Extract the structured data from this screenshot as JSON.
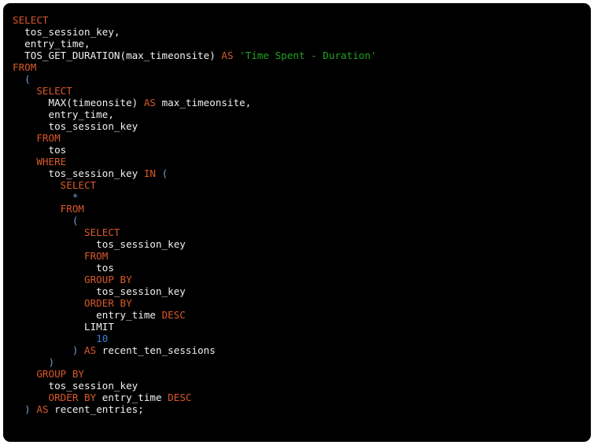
{
  "window": {
    "background_color": "#ffffff",
    "code_background_color": "#000000",
    "corner_radius_px": 9
  },
  "theme": {
    "keyword_color": "#d9582a",
    "string_color": "#1fa51f",
    "number_color": "#3b7fd4",
    "punctuation_color": "#6f9fd8",
    "identifier_color": "#f0f0f0"
  },
  "code": {
    "language": "sql",
    "full_text": "SELECT\n  tos_session_key,\n  entry_time,\n  TOS_GET_DURATION(max_timeonsite) AS 'Time Spent - Duration'\nFROM\n  (\n    SELECT\n      MAX(timeonsite) AS max_timeonsite,\n      entry_time,\n      tos_session_key\n    FROM\n      tos\n    WHERE\n      tos_session_key IN (\n        SELECT\n          *\n        FROM\n          (\n            SELECT\n              tos_session_key\n            FROM\n              tos\n            GROUP BY\n              tos_session_key\n            ORDER BY\n              entry_time DESC\n            LIMIT\n              10\n          ) AS recent_ten_sessions\n      )\n    GROUP BY\n      tos_session_key\n      ORDER BY entry_time DESC\n  ) AS recent_entries;",
    "lines": [
      {
        "n": 1,
        "text": "SELECT"
      },
      {
        "n": 2,
        "text": "  tos_session_key,"
      },
      {
        "n": 3,
        "text": "  entry_time,"
      },
      {
        "n": 4,
        "text": "  TOS_GET_DURATION(max_timeonsite) AS 'Time Spent - Duration'"
      },
      {
        "n": 5,
        "text": "FROM"
      },
      {
        "n": 6,
        "text": "  ("
      },
      {
        "n": 7,
        "text": "    SELECT"
      },
      {
        "n": 8,
        "text": "      MAX(timeonsite) AS max_timeonsite,"
      },
      {
        "n": 9,
        "text": "      entry_time,"
      },
      {
        "n": 10,
        "text": "      tos_session_key"
      },
      {
        "n": 11,
        "text": "    FROM"
      },
      {
        "n": 12,
        "text": "      tos"
      },
      {
        "n": 13,
        "text": "    WHERE"
      },
      {
        "n": 14,
        "text": "      tos_session_key IN ("
      },
      {
        "n": 15,
        "text": "        SELECT"
      },
      {
        "n": 16,
        "text": "          *"
      },
      {
        "n": 17,
        "text": "        FROM"
      },
      {
        "n": 18,
        "text": "          ("
      },
      {
        "n": 19,
        "text": "            SELECT"
      },
      {
        "n": 20,
        "text": "              tos_session_key"
      },
      {
        "n": 21,
        "text": "            FROM"
      },
      {
        "n": 22,
        "text": "              tos"
      },
      {
        "n": 23,
        "text": "            GROUP BY"
      },
      {
        "n": 24,
        "text": "              tos_session_key"
      },
      {
        "n": 25,
        "text": "            ORDER BY"
      },
      {
        "n": 26,
        "text": "              entry_time DESC"
      },
      {
        "n": 27,
        "text": "            LIMIT"
      },
      {
        "n": 28,
        "text": "              10"
      },
      {
        "n": 29,
        "text": "          ) AS recent_ten_sessions"
      },
      {
        "n": 30,
        "text": "      )"
      },
      {
        "n": 31,
        "text": "    GROUP BY"
      },
      {
        "n": 32,
        "text": "      tos_session_key"
      },
      {
        "n": 33,
        "text": "      ORDER BY entry_time DESC"
      },
      {
        "n": 34,
        "text": "  ) AS recent_entries;"
      }
    ],
    "tokens": [
      [
        {
          "t": "SELECT",
          "c": "kw"
        }
      ],
      [
        {
          "t": "  ",
          "c": "plain"
        },
        {
          "t": "tos_session_key,",
          "c": "id"
        }
      ],
      [
        {
          "t": "  ",
          "c": "plain"
        },
        {
          "t": "entry_time,",
          "c": "id"
        }
      ],
      [
        {
          "t": "  ",
          "c": "plain"
        },
        {
          "t": "TOS_GET_DURATION(max_timeonsite) ",
          "c": "id"
        },
        {
          "t": "AS",
          "c": "kw"
        },
        {
          "t": " ",
          "c": "plain"
        },
        {
          "t": "'Time Spent - Duration'",
          "c": "str"
        }
      ],
      [
        {
          "t": "FROM",
          "c": "kw"
        }
      ],
      [
        {
          "t": "  ",
          "c": "plain"
        },
        {
          "t": "(",
          "c": "punc"
        }
      ],
      [
        {
          "t": "    ",
          "c": "plain"
        },
        {
          "t": "SELECT",
          "c": "kw"
        }
      ],
      [
        {
          "t": "      ",
          "c": "plain"
        },
        {
          "t": "MAX(timeonsite) ",
          "c": "id"
        },
        {
          "t": "AS",
          "c": "kw"
        },
        {
          "t": " max_timeonsite,",
          "c": "id"
        }
      ],
      [
        {
          "t": "      ",
          "c": "plain"
        },
        {
          "t": "entry_time,",
          "c": "id"
        }
      ],
      [
        {
          "t": "      ",
          "c": "plain"
        },
        {
          "t": "tos_session_key",
          "c": "id"
        }
      ],
      [
        {
          "t": "    ",
          "c": "plain"
        },
        {
          "t": "FROM",
          "c": "kw"
        }
      ],
      [
        {
          "t": "      ",
          "c": "plain"
        },
        {
          "t": "tos",
          "c": "id"
        }
      ],
      [
        {
          "t": "    ",
          "c": "plain"
        },
        {
          "t": "WHERE",
          "c": "kw"
        }
      ],
      [
        {
          "t": "      ",
          "c": "plain"
        },
        {
          "t": "tos_session_key ",
          "c": "id"
        },
        {
          "t": "IN",
          "c": "kw"
        },
        {
          "t": " ",
          "c": "plain"
        },
        {
          "t": "(",
          "c": "punc"
        }
      ],
      [
        {
          "t": "        ",
          "c": "plain"
        },
        {
          "t": "SELECT",
          "c": "kw"
        }
      ],
      [
        {
          "t": "          ",
          "c": "plain"
        },
        {
          "t": "*",
          "c": "punc"
        }
      ],
      [
        {
          "t": "        ",
          "c": "plain"
        },
        {
          "t": "FROM",
          "c": "kw"
        }
      ],
      [
        {
          "t": "          ",
          "c": "plain"
        },
        {
          "t": "(",
          "c": "punc"
        }
      ],
      [
        {
          "t": "            ",
          "c": "plain"
        },
        {
          "t": "SELECT",
          "c": "kw"
        }
      ],
      [
        {
          "t": "              ",
          "c": "plain"
        },
        {
          "t": "tos_session_key",
          "c": "id"
        }
      ],
      [
        {
          "t": "            ",
          "c": "plain"
        },
        {
          "t": "FROM",
          "c": "kw"
        }
      ],
      [
        {
          "t": "              ",
          "c": "plain"
        },
        {
          "t": "tos",
          "c": "id"
        }
      ],
      [
        {
          "t": "            ",
          "c": "plain"
        },
        {
          "t": "GROUP BY",
          "c": "kw"
        }
      ],
      [
        {
          "t": "              ",
          "c": "plain"
        },
        {
          "t": "tos_session_key",
          "c": "id"
        }
      ],
      [
        {
          "t": "            ",
          "c": "plain"
        },
        {
          "t": "ORDER BY",
          "c": "kw"
        }
      ],
      [
        {
          "t": "              ",
          "c": "plain"
        },
        {
          "t": "entry_time ",
          "c": "id"
        },
        {
          "t": "DESC",
          "c": "kw"
        }
      ],
      [
        {
          "t": "            ",
          "c": "plain"
        },
        {
          "t": "LIMIT",
          "c": "id"
        }
      ],
      [
        {
          "t": "              ",
          "c": "plain"
        },
        {
          "t": "10",
          "c": "num"
        }
      ],
      [
        {
          "t": "          ",
          "c": "plain"
        },
        {
          "t": ")",
          "c": "punc"
        },
        {
          "t": " ",
          "c": "plain"
        },
        {
          "t": "AS",
          "c": "kw"
        },
        {
          "t": " recent_ten_sessions",
          "c": "id"
        }
      ],
      [
        {
          "t": "      ",
          "c": "plain"
        },
        {
          "t": ")",
          "c": "punc"
        }
      ],
      [
        {
          "t": "    ",
          "c": "plain"
        },
        {
          "t": "GROUP BY",
          "c": "kw"
        }
      ],
      [
        {
          "t": "      ",
          "c": "plain"
        },
        {
          "t": "tos_session_key",
          "c": "id"
        }
      ],
      [
        {
          "t": "      ",
          "c": "plain"
        },
        {
          "t": "ORDER BY",
          "c": "kw"
        },
        {
          "t": " entry_time ",
          "c": "id"
        },
        {
          "t": "DESC",
          "c": "kw"
        }
      ],
      [
        {
          "t": "  ",
          "c": "plain"
        },
        {
          "t": ")",
          "c": "punc"
        },
        {
          "t": " ",
          "c": "plain"
        },
        {
          "t": "AS",
          "c": "kw"
        },
        {
          "t": " recent_entries;",
          "c": "id"
        }
      ]
    ]
  }
}
